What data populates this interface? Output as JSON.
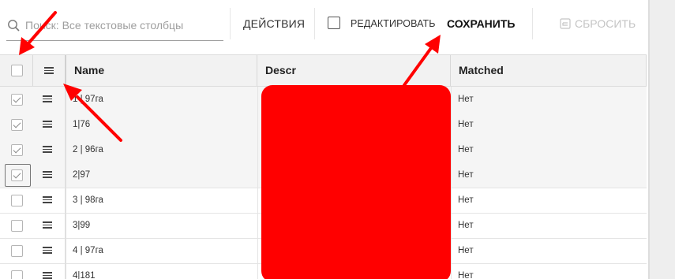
{
  "toolbar": {
    "search_placeholder": "Поиск: Все текстовые столбцы",
    "actions_label": "ДЕЙСТВИЯ",
    "edit_label": "РЕДАКТИРОВАТЬ",
    "save_label": "СОХРАНИТЬ",
    "reset_label": "СБРОСИТЬ"
  },
  "columns": {
    "name": "Name",
    "descr": "Descr",
    "matched": "Matched"
  },
  "rows": [
    {
      "name": "1 | 97га",
      "matched": "Нет",
      "checked": true
    },
    {
      "name": "1|76",
      "matched": "Нет",
      "checked": true
    },
    {
      "name": "2 | 96га",
      "matched": "Нет",
      "checked": true
    },
    {
      "name": "2|97",
      "matched": "Нет",
      "checked": true
    },
    {
      "name": "3 | 98га",
      "matched": "Нет",
      "checked": false
    },
    {
      "name": "3|99",
      "matched": "Нет",
      "checked": false
    },
    {
      "name": "4 | 97га",
      "matched": "Нет",
      "checked": false
    },
    {
      "name": "4|181",
      "matched": "Нет",
      "checked": false
    }
  ],
  "icons": {
    "search": "search-icon",
    "column_menu": "menu-icon",
    "reset": "reset-icon"
  },
  "colors": {
    "annotation": "#ff0000",
    "redaction": "#ff0000",
    "header_bg": "#f2f2f2"
  }
}
